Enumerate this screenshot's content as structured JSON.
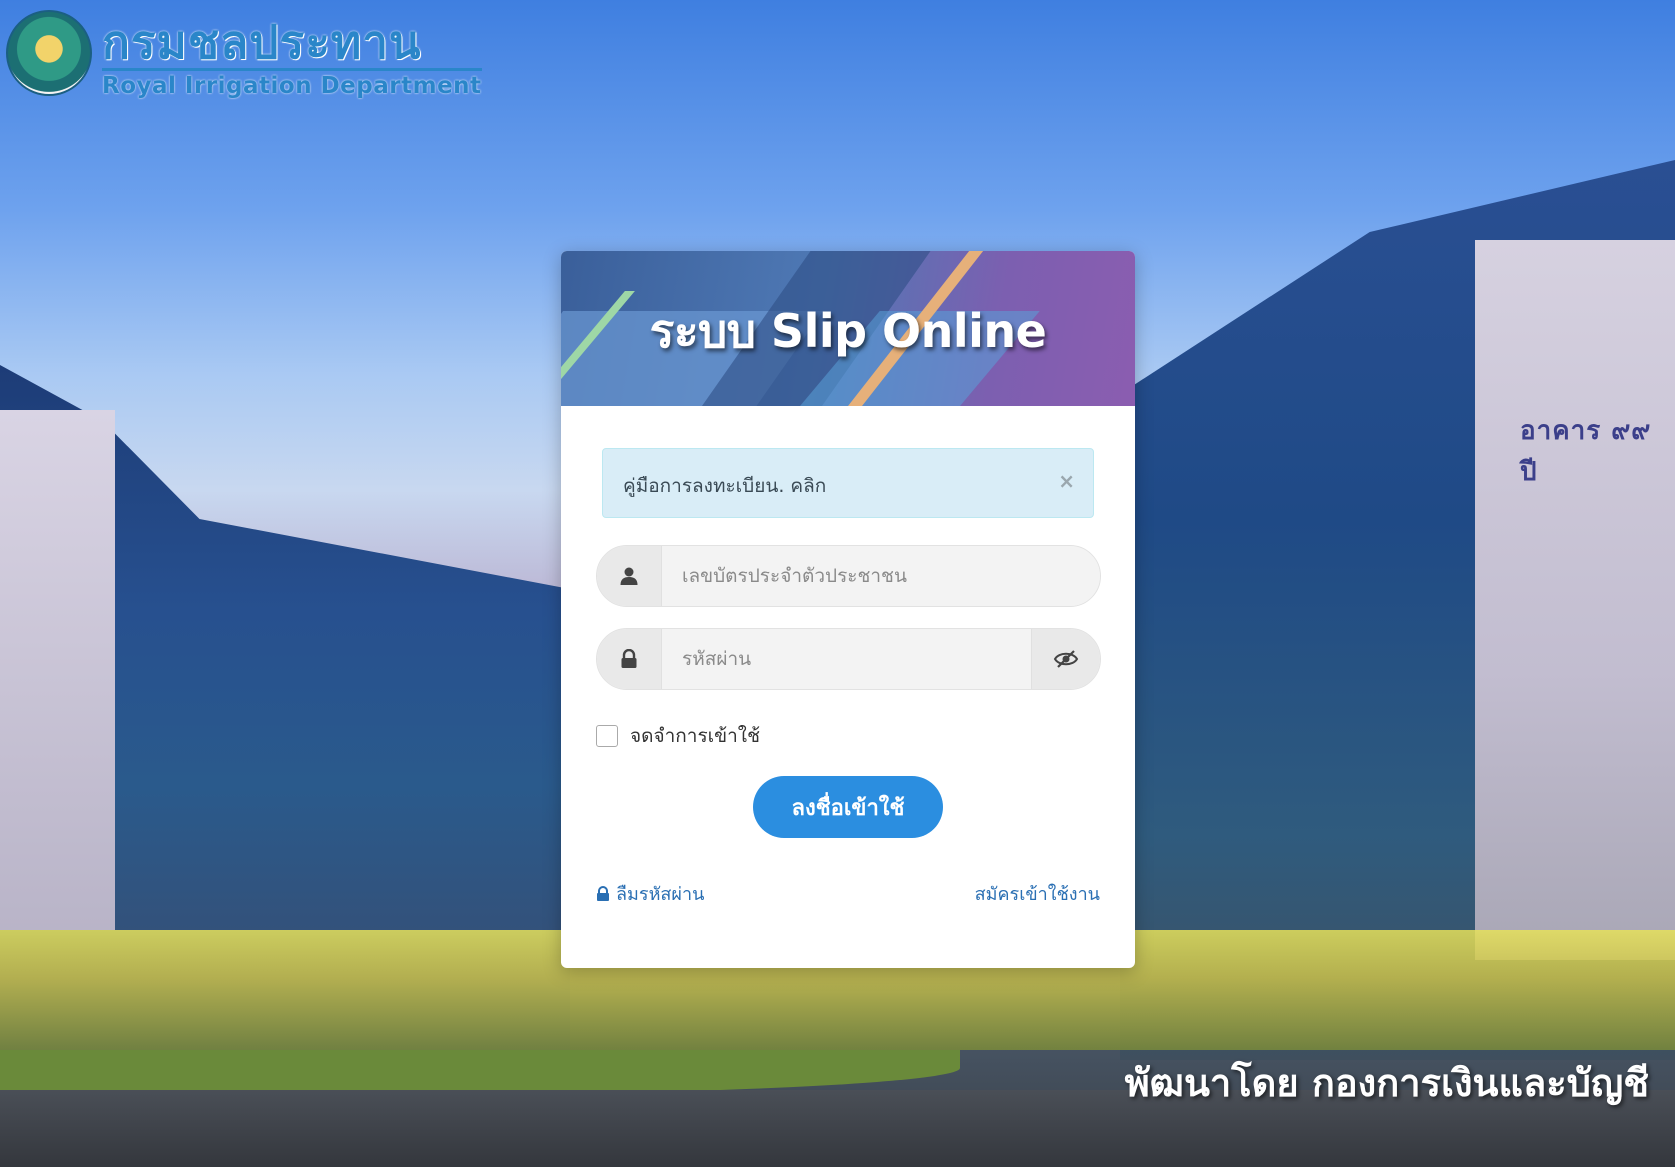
{
  "brand": {
    "name_th": "กรมชลประทาน",
    "name_en": "Royal Irrigation Department",
    "seal_icon": "royal-irrigation-seal"
  },
  "background": {
    "building_sign": "อาคาร ๙๙ ปี"
  },
  "card": {
    "title": "ระบบ Slip Online",
    "alert": {
      "text": "คู่มือการลงทะเบียน. คลิก",
      "close_label": "×"
    },
    "username": {
      "placeholder": "เลขบัตรประจำตัวประชาชน",
      "value": "",
      "icon": "user-icon"
    },
    "password": {
      "placeholder": "รหัสผ่าน",
      "value": "",
      "icon": "lock-icon",
      "toggle_icon": "eye-slash-icon"
    },
    "remember_label": "จดจำการเข้าใช้",
    "login_button": "ลงชื่อเข้าใช้",
    "forgot_link": "ลืมรหัสผ่าน",
    "register_link": "สมัครเข้าใช้งาน"
  },
  "footer": {
    "credit": "พัฒนาโดย กองการเงินและบัญชี"
  },
  "colors": {
    "primary": "#2b8ee0",
    "link": "#2a6fb3",
    "alert_bg": "#d9edf7",
    "brand": "#2a86c9"
  }
}
